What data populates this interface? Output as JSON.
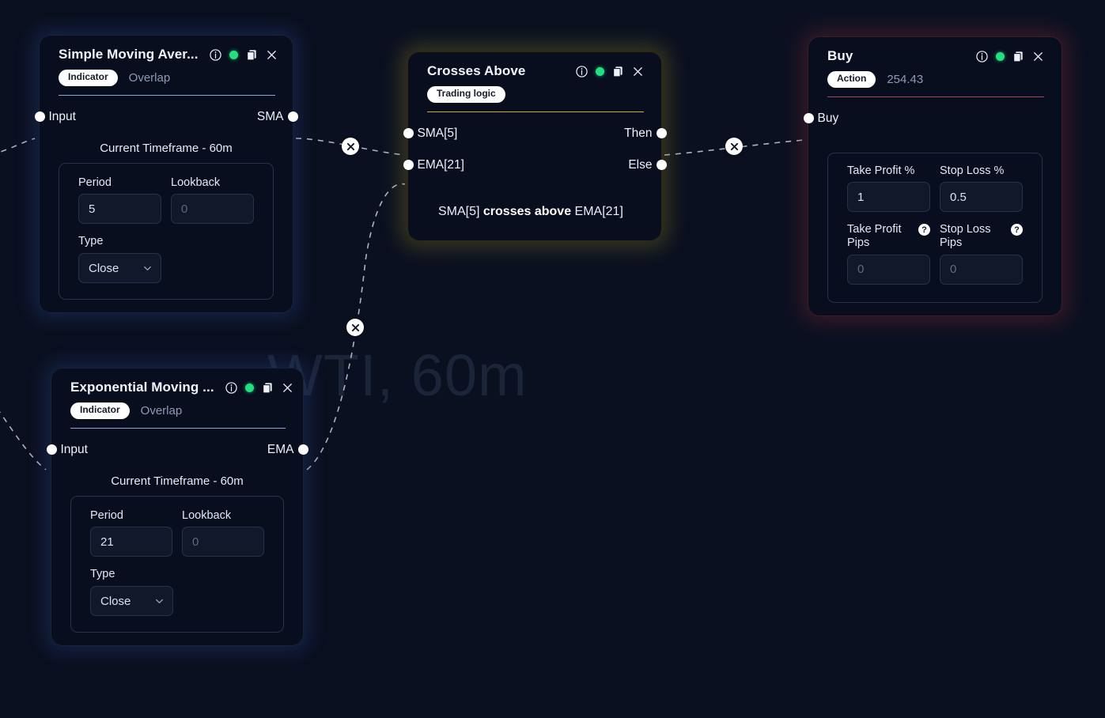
{
  "canvas": {
    "watermark": "WTI, 60m",
    "background_color": "#0b1020"
  },
  "icons": {
    "info": "info-icon",
    "status": "status-dot-icon",
    "duplicate": "duplicate-icon",
    "close": "close-icon",
    "chevron": "chevron-down-icon",
    "help": "?",
    "edge_delete": "close-x-icon"
  },
  "nodes": {
    "sma": {
      "title": "Simple Moving Aver...",
      "category_pill": "Indicator",
      "secondary_tab": "Overlap",
      "accent_color": "#8fa3dd",
      "ports": {
        "input": "Input",
        "output": "SMA"
      },
      "timeframe": "Current Timeframe - 60m",
      "fields": {
        "period_label": "Period",
        "period_value": "5",
        "lookback_label": "Lookback",
        "lookback_placeholder": "0",
        "lookback_value": "",
        "type_label": "Type",
        "type_value": "Close"
      }
    },
    "ema": {
      "title": "Exponential Moving ...",
      "category_pill": "Indicator",
      "secondary_tab": "Overlap",
      "accent_color": "#8fa3dd",
      "ports": {
        "input": "Input",
        "output": "EMA"
      },
      "timeframe": "Current Timeframe - 60m",
      "fields": {
        "period_label": "Period",
        "period_value": "21",
        "lookback_label": "Lookback",
        "lookback_placeholder": "0",
        "lookback_value": "",
        "type_label": "Type",
        "type_value": "Close"
      }
    },
    "logic": {
      "title": "Crosses Above",
      "category_pill": "Trading logic",
      "accent_color": "#cfae26",
      "ports": {
        "input_a": "SMA[5]",
        "input_b": "EMA[21]",
        "output_then": "Then",
        "output_else": "Else"
      },
      "expression": {
        "left": "SMA[5] ",
        "operator": "crosses above",
        "right": " EMA[21]"
      }
    },
    "buy": {
      "title": "Buy",
      "category_pill": "Action",
      "price": "254.43",
      "accent_color": "#a8444f",
      "ports": {
        "input": "Buy"
      },
      "fields": {
        "take_profit_pct_label": "Take Profit %",
        "take_profit_pct_value": "1",
        "stop_loss_pct_label": "Stop Loss %",
        "stop_loss_pct_value": "0.5",
        "take_profit_pips_label": "Take Profit\nPips",
        "take_profit_pips_placeholder": "0",
        "take_profit_pips_value": "",
        "stop_loss_pips_label": "Stop Loss\nPips",
        "stop_loss_pips_placeholder": "0",
        "stop_loss_pips_value": ""
      }
    }
  },
  "edges": [
    {
      "id": "sma-to-logic",
      "delete_label": "×"
    },
    {
      "id": "ema-to-logic",
      "delete_label": "×"
    },
    {
      "id": "logic-to-buy",
      "delete_label": "×"
    }
  ]
}
